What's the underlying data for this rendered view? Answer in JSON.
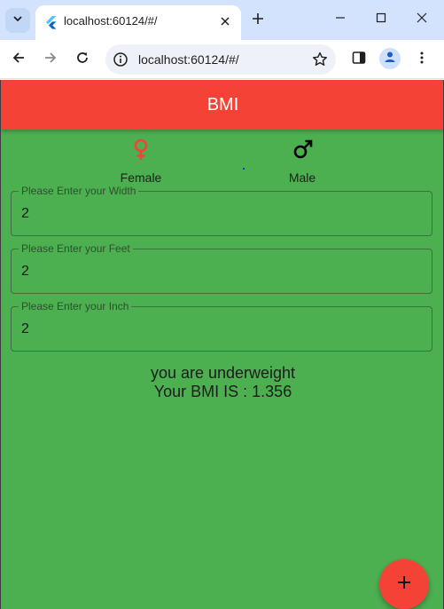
{
  "browser": {
    "tab_title": "localhost:60124/#/",
    "url": "localhost:60124/#/"
  },
  "app": {
    "title": "BMI",
    "colors": {
      "appbar": "#f44336",
      "background": "#4caf50",
      "fab": "#f44336",
      "female_icon": "#f44336",
      "male_icon": "#000000"
    },
    "gender": {
      "female_label": "Female",
      "male_label": "Male",
      "female_icon": "female-symbol-icon",
      "male_icon": "male-symbol-icon"
    },
    "fields": {
      "width_label": "Please Enter your Width",
      "width_value": "2",
      "feet_label": "Please Enter your Feet",
      "feet_value": "2",
      "inch_label": "Please Enter your Inch",
      "inch_value": "2"
    },
    "result": {
      "status": "you are underweight",
      "bmi": "Your BMI IS : 1.356"
    },
    "fab_icon": "plus-icon"
  }
}
